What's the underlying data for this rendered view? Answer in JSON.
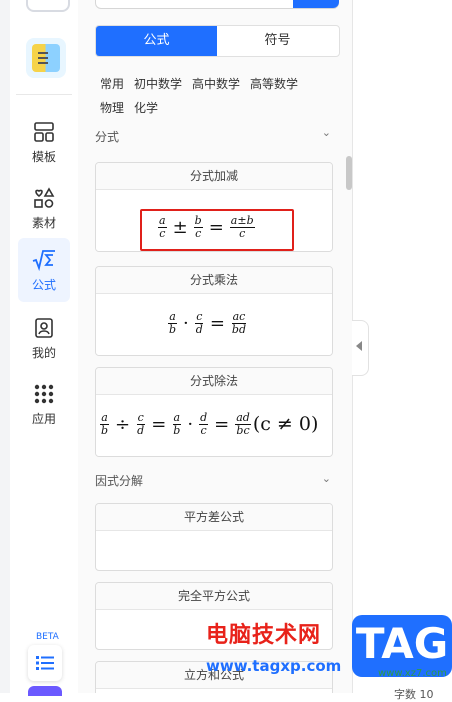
{
  "sidebar": {
    "items": [
      {
        "label": "模板",
        "icon": "template-icon"
      },
      {
        "label": "素材",
        "icon": "shapes-icon"
      },
      {
        "label": "公式",
        "icon": "sqrt-sigma-icon",
        "active": true
      },
      {
        "label": "我的",
        "icon": "portrait-icon"
      },
      {
        "label": "应用",
        "icon": "apps-grid-icon"
      }
    ],
    "beta_label": "BETA"
  },
  "panel": {
    "tabs": [
      {
        "label": "公式",
        "active": true
      },
      {
        "label": "符号",
        "active": false
      }
    ],
    "categories": [
      "常用",
      "初中数学",
      "高中数学",
      "高等数学",
      "物理",
      "化学"
    ],
    "sections": [
      {
        "label": "分式",
        "cards": [
          {
            "title": "分式加减",
            "highlighted": true
          },
          {
            "title": "分式乘法"
          },
          {
            "title": "分式除法"
          }
        ]
      },
      {
        "label": "因式分解",
        "cards": [
          {
            "title": "平方差公式"
          },
          {
            "title": "完全平方公式"
          },
          {
            "title": "立方和公式"
          }
        ]
      }
    ]
  },
  "formulas": {
    "add": {
      "a1": "a",
      "c1": "c",
      "pm": "±",
      "b": "b",
      "c2": "c",
      "eq": "=",
      "num": "a±b",
      "den": "c"
    },
    "mul": {
      "a": "a",
      "b": "b",
      "dot": "·",
      "c": "c",
      "d": "d",
      "eq": "=",
      "num": "ac",
      "den": "bd"
    },
    "div": {
      "a": "a",
      "b": "b",
      "div": "÷",
      "c": "c",
      "d": "d",
      "eq1": "=",
      "a2": "a",
      "b2": "b",
      "dot": "·",
      "d2": "d",
      "c2": "c",
      "eq2": "=",
      "num": "ad",
      "den": "bc",
      "cond": "(c ≠ 0)"
    }
  },
  "watermark": {
    "text": "电脑技术网",
    "url": "www.tagxp.com",
    "badge": "TAG",
    "site2": "www.xz7.com",
    "bottom_text": "字数 10"
  },
  "colors": {
    "accent": "#1f6fff",
    "highlight": "#e0201a"
  }
}
